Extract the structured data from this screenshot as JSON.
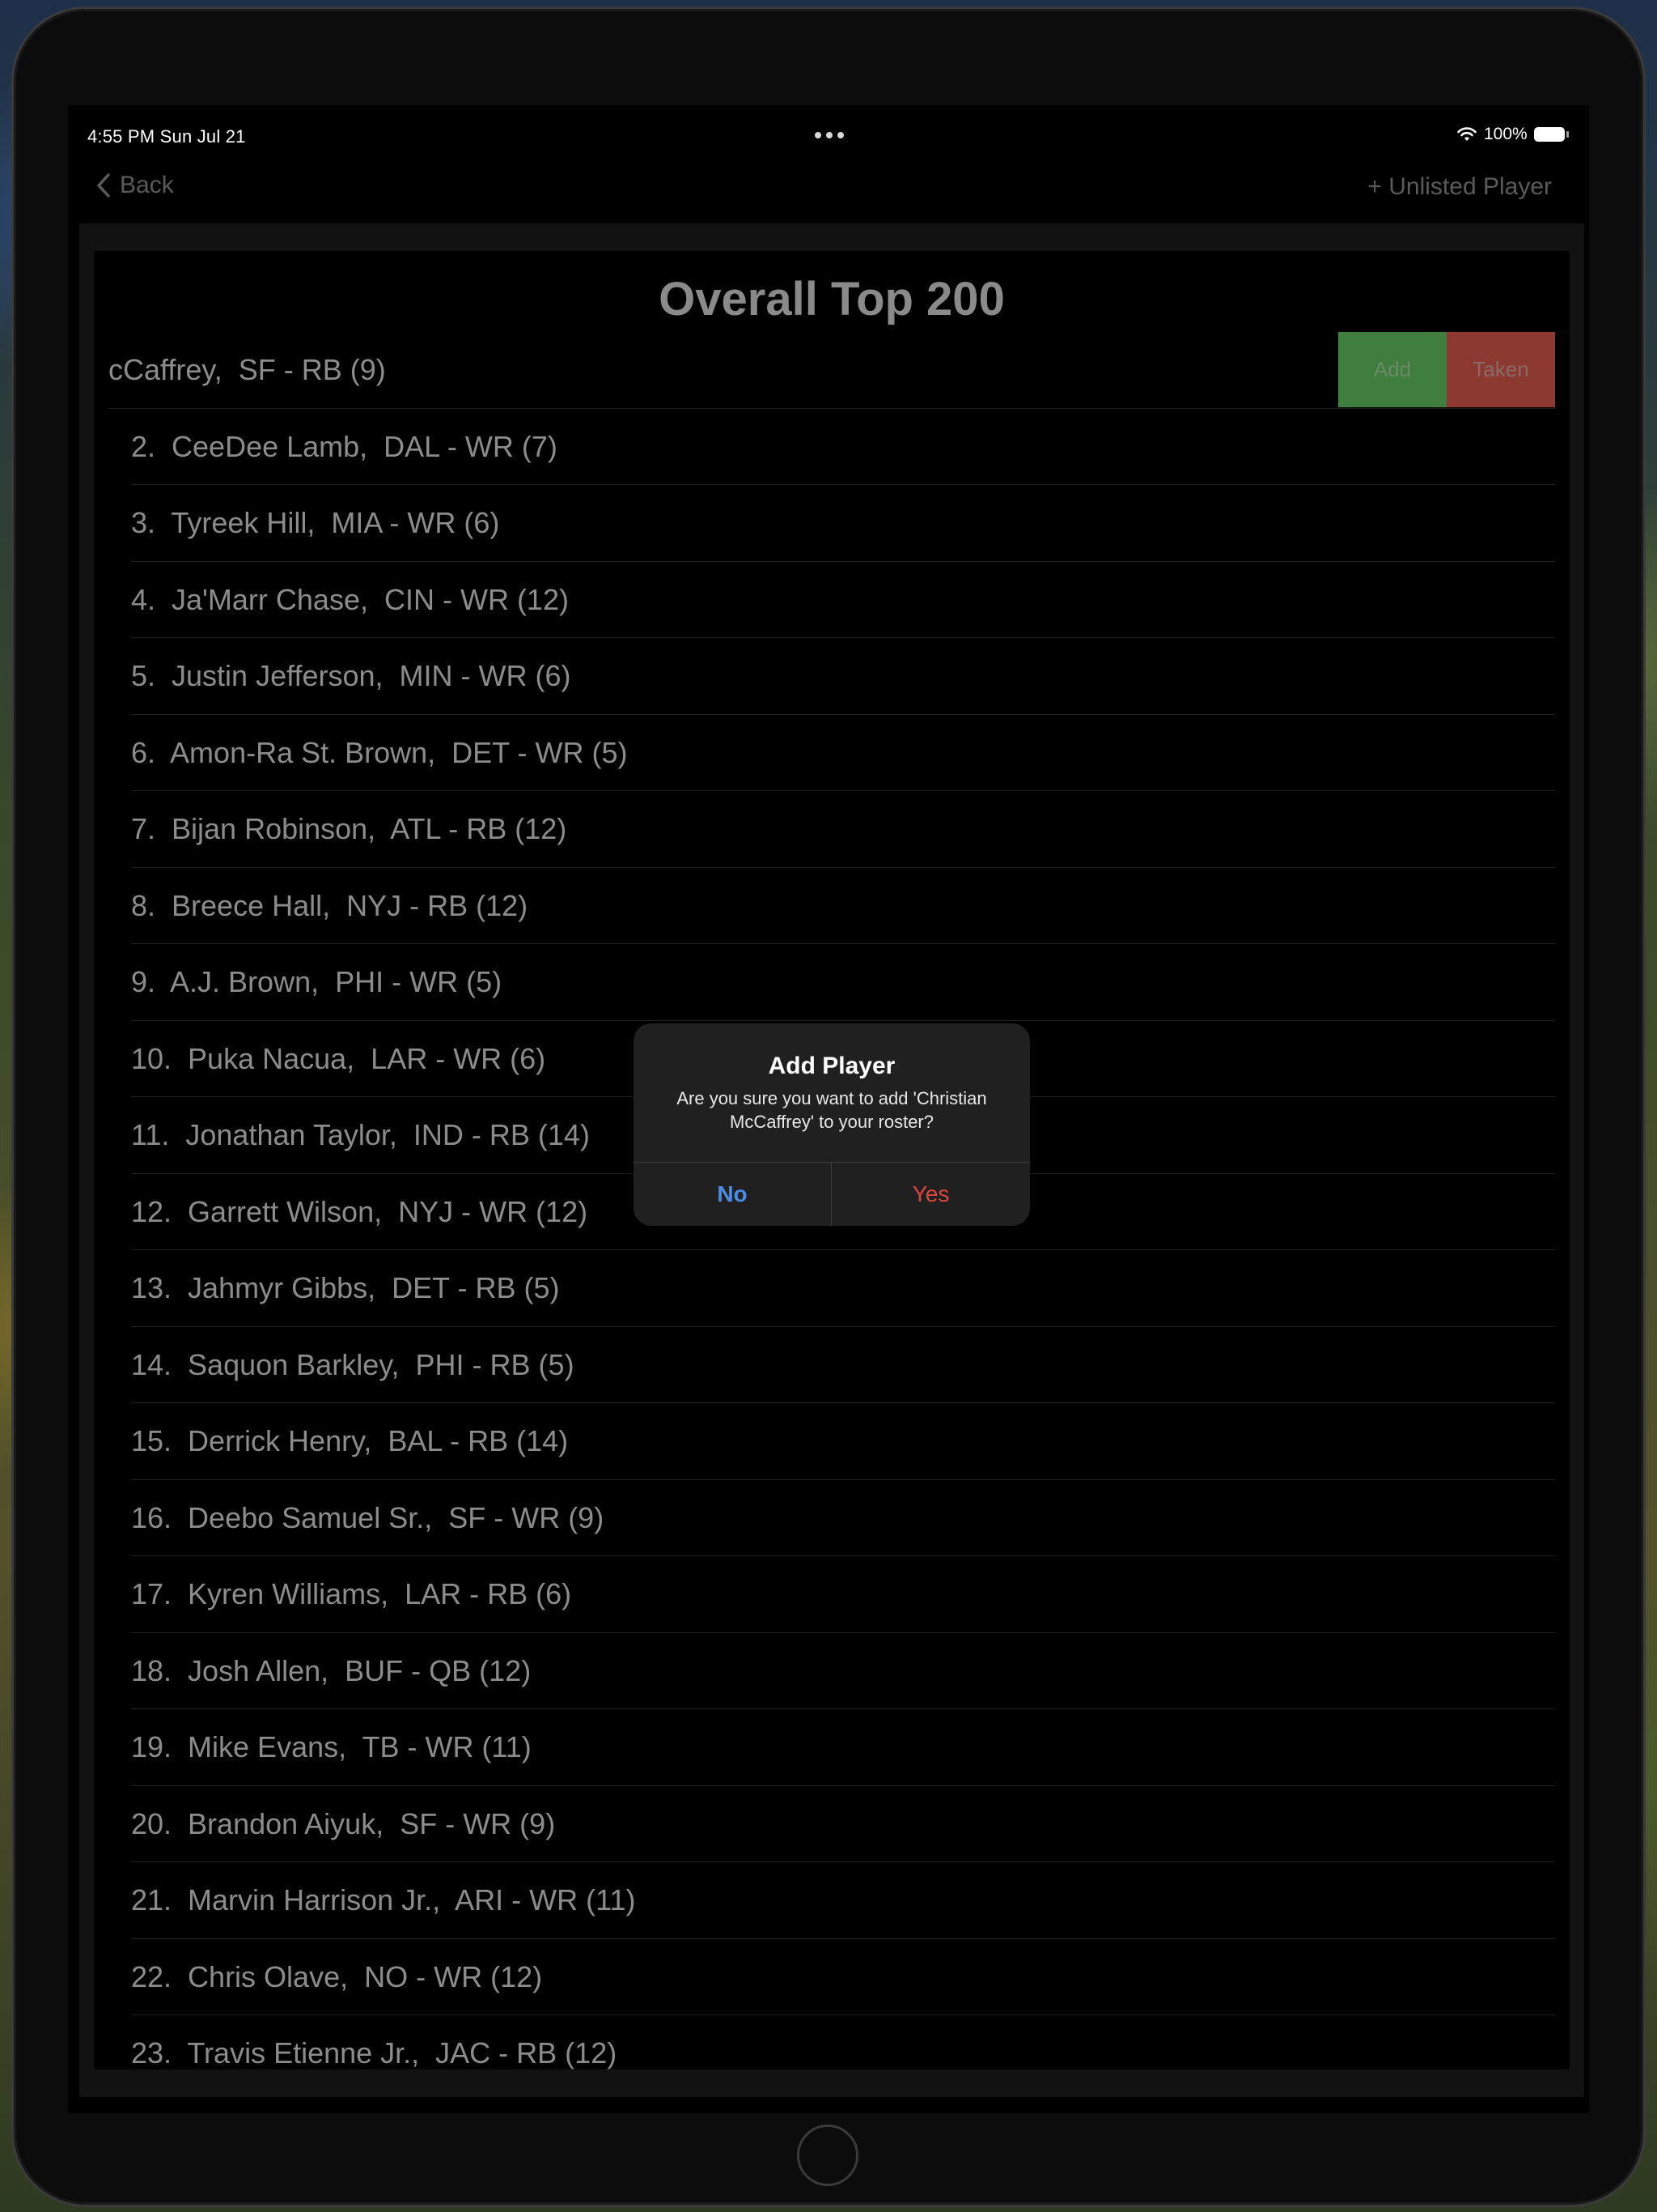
{
  "status_bar": {
    "time": "4:55 PM   Sun Jul 21",
    "battery": "100%",
    "icons": [
      "wifi-icon",
      "battery-icon",
      "more-dots-icon"
    ]
  },
  "nav": {
    "back_label": "Back",
    "unlisted_label": "+ Unlisted Player"
  },
  "list": {
    "title": "Overall Top 200",
    "swiped_row": {
      "label": "cCaffrey,  SF - RB (9)",
      "add_label": "Add",
      "taken_label": "Taken"
    },
    "rows": [
      "2.  CeeDee Lamb,  DAL - WR (7)",
      "3.  Tyreek Hill,  MIA - WR (6)",
      "4.  Ja'Marr Chase,  CIN - WR (12)",
      "5.  Justin Jefferson,  MIN - WR (6)",
      "6.  Amon-Ra St. Brown,  DET - WR (5)",
      "7.  Bijan Robinson,  ATL - RB (12)",
      "8.  Breece Hall,  NYJ - RB (12)",
      "9.  A.J. Brown,  PHI - WR (5)",
      "10.  Puka Nacua,  LAR - WR (6)",
      "11.  Jonathan Taylor,  IND - RB (14)",
      "12.  Garrett Wilson,  NYJ - WR (12)",
      "13.  Jahmyr Gibbs,  DET - RB (5)",
      "14.  Saquon Barkley,  PHI - RB (5)",
      "15.  Derrick Henry,  BAL - RB (14)",
      "16.  Deebo Samuel Sr.,  SF - WR (9)",
      "17.  Kyren Williams,  LAR - RB (6)",
      "18.  Josh Allen,  BUF - QB (12)",
      "19.  Mike Evans,  TB - WR (11)",
      "20.  Brandon Aiyuk,  SF - WR (9)",
      "21.  Marvin Harrison Jr.,  ARI - WR (11)",
      "22.  Chris Olave,  NO - WR (12)",
      "23.  Travis Etienne Jr.,  JAC - RB (12)"
    ]
  },
  "alert": {
    "title": "Add Player",
    "message": "Are you sure you want to add 'Christian McCaffrey' to your roster?",
    "no_label": "No",
    "yes_label": "Yes"
  },
  "colors": {
    "add_button": "#3f7e3e",
    "taken_button": "#8c3a31",
    "alert_no": "#4c8de8",
    "alert_yes": "#e0453c"
  }
}
